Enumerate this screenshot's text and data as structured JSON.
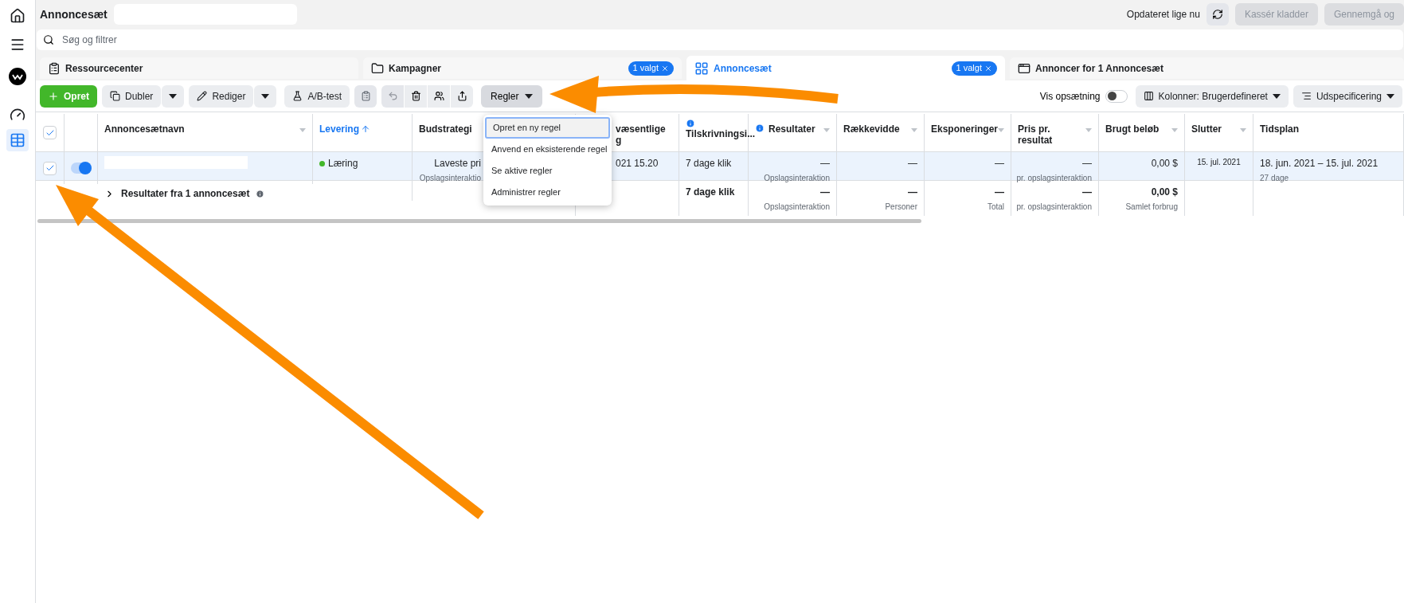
{
  "sidebar": {
    "items": [
      {
        "selected": false
      },
      {
        "selected": false
      },
      {
        "selected": false
      },
      {
        "selected": false
      },
      {
        "selected": true
      }
    ]
  },
  "header": {
    "title": "Annoncesæt",
    "status": "Opdateret lige nu",
    "buttons": [
      {
        "label": "Kassér kladder",
        "disabled": true
      },
      {
        "label": "Gennemgå og",
        "disabled": true
      }
    ]
  },
  "search": {
    "placeholder": "Søg og filtrer"
  },
  "tabs": [
    {
      "label": "Ressourcecenter",
      "selected": false
    },
    {
      "label": "Kampagner",
      "selected": false,
      "badge": "1 valgt"
    },
    {
      "label": "Annoncesæt",
      "selected": true,
      "badge": "1 valgt"
    },
    {
      "label": "Annoncer for 1 Annoncesæt",
      "selected": false
    }
  ],
  "toolbar": {
    "create": "Opret",
    "duplicate": "Dubler",
    "edit": "Rediger",
    "ab_test": "A/B-test",
    "rules": "Regler",
    "rules_open": true,
    "view_setup": {
      "label": "Vis opsætning",
      "on": false
    },
    "columns": "Kolonner: Brugerdefineret",
    "breakdown": "Udspecificering"
  },
  "rules_menu": [
    {
      "label": "Opret en ny regel",
      "selected": true
    },
    {
      "label": "Anvend en eksisterende regel",
      "selected": false
    },
    {
      "label": "Se aktive regler",
      "selected": false
    },
    {
      "label": "Administrer regler",
      "selected": false
    }
  ],
  "table": {
    "all_checked": true,
    "columns": [
      {
        "label": "Annoncesætnavn",
        "menu": true,
        "info": false,
        "sorted": false
      },
      {
        "label": "Levering",
        "menu": false,
        "info": false,
        "sorted": true
      },
      {
        "label": "Budstrategi",
        "menu": false,
        "info": false,
        "sorted": false
      },
      {
        "label": "væsentlige\ng",
        "menu": false,
        "info": false,
        "sorted": false
      },
      {
        "label": "Tilskrivningsi...",
        "menu": false,
        "info": true,
        "sorted": false
      },
      {
        "label": "Resultater",
        "menu": true,
        "info": true,
        "sorted": false
      },
      {
        "label": "Rækkevidde",
        "menu": true,
        "info": false,
        "sorted": false
      },
      {
        "label": "Eksponeringer",
        "menu": true,
        "info": false,
        "sorted": false
      },
      {
        "label": "Pris pr.\nresultat",
        "menu": true,
        "info": false,
        "sorted": false
      },
      {
        "label": "Brugt beløb",
        "menu": true,
        "info": false,
        "sorted": false
      },
      {
        "label": "Slutter",
        "menu": true,
        "info": false,
        "sorted": false
      },
      {
        "label": "Tidsplan",
        "menu": false,
        "info": false,
        "sorted": false
      }
    ],
    "rows": [
      {
        "checked": true,
        "on": true,
        "cells": [
          {},
          {
            "text": "Læring",
            "color": "#42b72a"
          },
          {
            "text": "Laveste pri",
            "sub": "Opslagsinteraktio"
          },
          {
            "text": "021 15.20"
          },
          {
            "text": "7 dage klik"
          },
          {
            "text": "—",
            "sub": "Opslagsinteraktion"
          },
          {
            "text": "—"
          },
          {
            "text": "—"
          },
          {
            "text": "—",
            "sub": "pr. opslagsinteraktion"
          },
          {
            "text": "0,00 $"
          },
          {
            "text": "15. jul. 2021",
            "small": true
          },
          {
            "text": "18. jun. 2021 – 15. jul. 2021",
            "sub": "27 dage"
          }
        ]
      }
    ],
    "summary": {
      "label": "Resultater fra 1 annoncesæt",
      "cells": [
        {},
        {},
        {},
        {},
        {
          "text": "7 dage klik"
        },
        {
          "text": "—",
          "sub": "Opslagsinteraktion"
        },
        {
          "text": "—",
          "sub": "Personer"
        },
        {
          "text": "—",
          "sub": "Total"
        },
        {
          "text": "—",
          "sub": "pr. opslagsinteraktion"
        },
        {
          "text": "0,00 $",
          "sub": "Samlet forbrug"
        },
        {},
        {}
      ]
    }
  }
}
